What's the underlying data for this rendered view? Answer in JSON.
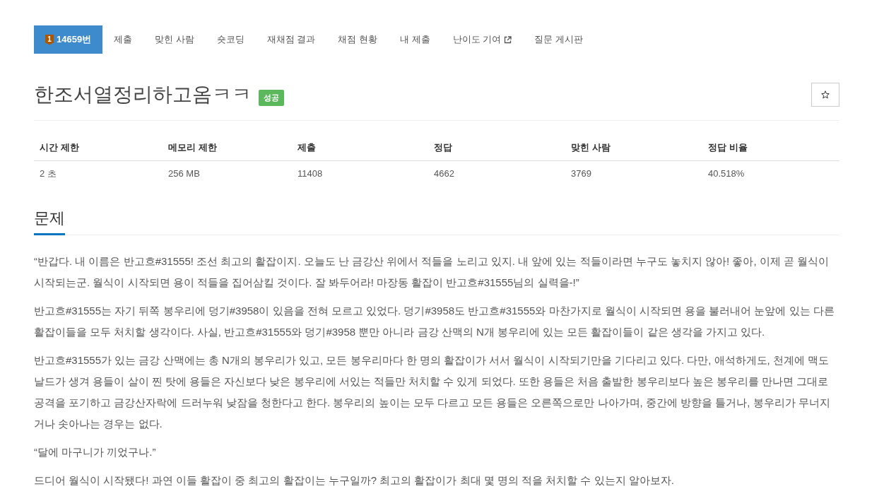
{
  "nav": {
    "tabs": [
      {
        "label": "14659번",
        "tier": "1",
        "selected": true,
        "external": false
      },
      {
        "label": "제출",
        "selected": false,
        "external": false
      },
      {
        "label": "맞힌 사람",
        "selected": false,
        "external": false
      },
      {
        "label": "숏코딩",
        "selected": false,
        "external": false
      },
      {
        "label": "재채점 결과",
        "selected": false,
        "external": false
      },
      {
        "label": "채점 현황",
        "selected": false,
        "external": false
      },
      {
        "label": "내 제출",
        "selected": false,
        "external": false
      },
      {
        "label": "난이도 기여",
        "selected": false,
        "external": true
      },
      {
        "label": "질문 게시판",
        "selected": false,
        "external": false
      }
    ]
  },
  "problem": {
    "title": "한조서열정리하고옴ㅋㅋ",
    "result_badge": "성공",
    "starred": false
  },
  "info_table": {
    "columns": [
      "시간 제한",
      "메모리 제한",
      "제출",
      "정답",
      "맞힌 사람",
      "정답 비율"
    ],
    "rows": [
      [
        "2 초",
        "256 MB",
        "11408",
        "4662",
        "3769",
        "40.518%"
      ]
    ]
  },
  "sections": [
    {
      "heading": "문제",
      "paragraphs": [
        "“반갑다. 내 이름은 반고흐#31555! 조선 최고의 활잡이지. 오늘도 난 금강산 위에서 적들을 노리고 있지. 내 앞에 있는 적들이라면 누구도 놓치지 않아! 좋아, 이제 곧 월식이 시작되는군. 월식이 시작되면 용이 적들을 집어삼킬 것이다. 잘 봐두어라! 마장동 활잡이 반고흐#31555님의 실력을-!”",
        "반고흐#31555는 자기 뒤쪽 봉우리에 덩기#3958이 있음을 전혀 모르고 있었다. 덩기#3958도 반고흐#31555와 마찬가지로 월식이 시작되면 용을 불러내어 눈앞에 있는 다른 활잡이들을 모두 처치할 생각이다. 사실, 반고흐#31555와 덩기#3958 뿐만 아니라 금강 산맥의 N개 봉우리에 있는 모든 활잡이들이 같은 생각을 가지고 있다.",
        "반고흐#31555가 있는 금강 산맥에는 총 N개의 봉우리가 있고, 모든 봉우리마다 한 명의 활잡이가 서서 월식이 시작되기만을 기다리고 있다. 다만, 애석하게도, 천계에 맥도날드가 생겨 용들이 살이 찐 탓에 용들은 자신보다 낮은 봉우리에 서있는 적들만 처치할 수 있게 되었다. 또한 용들은 처음 출발한 봉우리보다 높은 봉우리를 만나면 그대로 공격을 포기하고 금강산자락에 드러누워 낮잠을 청한다고 한다. 봉우리의 높이는 모두 다르고 모든 용들은 오른쪽으로만 나아가며, 중간에 방향을 틀거나, 봉우리가 무너지거나 솟아나는 경우는 없다.",
        "“달에 마구니가 끼었구나.”",
        "드디어 월식이 시작됐다! 과연 이들 활잡이 중 최고의 활잡이는 누구일까? 최고의 활잡이가 최대 몇 명의 적을 처치할 수 있는지 알아보자."
      ]
    }
  ]
}
